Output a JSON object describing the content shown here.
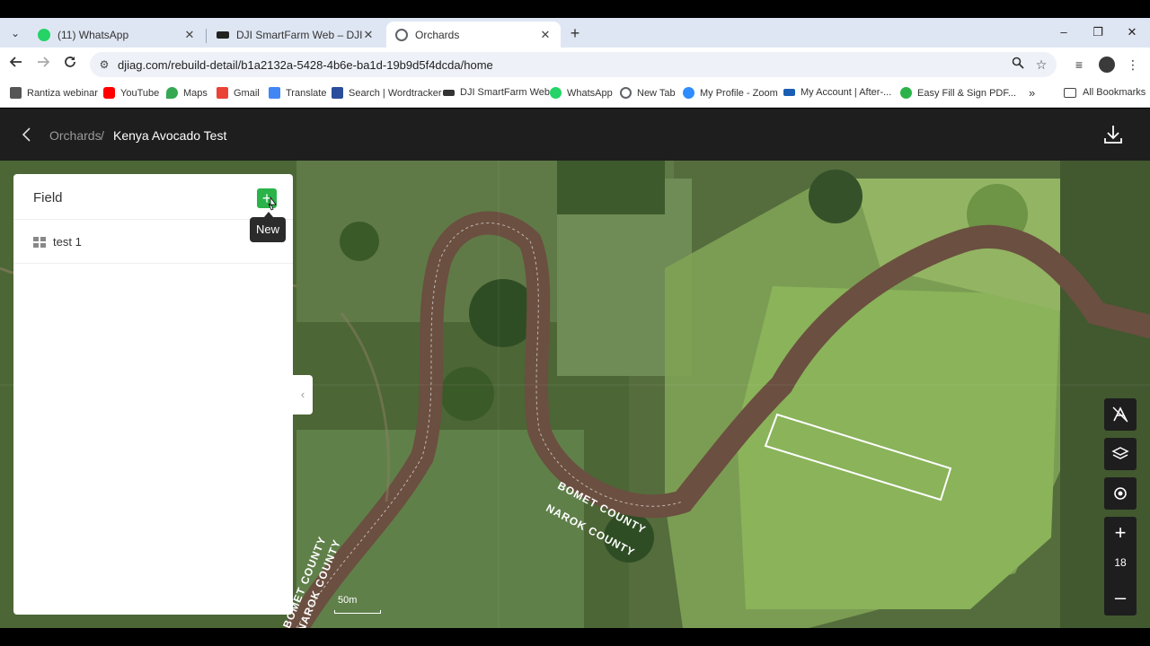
{
  "browser": {
    "tabs": [
      {
        "title": "(11) WhatsApp",
        "close": "✕",
        "favicon_color": "#25d366"
      },
      {
        "title": "DJI SmartFarm Web – DJI agricu",
        "close": "✕",
        "favicon_color": "#222222"
      },
      {
        "title": "Orchards",
        "close": "✕",
        "favicon_color": "#5f6368"
      }
    ],
    "new_tab": "+",
    "window": {
      "minimize": "–",
      "restore": "❐",
      "close": "✕"
    },
    "url": "djiag.com/rebuild-detail/b1a2132a-5428-4b6e-ba1d-19b9d5f4dcda/home",
    "bookmarks": [
      {
        "label": "Rantiza webinar",
        "color": "#555555"
      },
      {
        "label": "YouTube",
        "color": "#ff0000"
      },
      {
        "label": "Maps",
        "color": "#34a853"
      },
      {
        "label": "Gmail",
        "color": "#ea4335"
      },
      {
        "label": "Translate",
        "color": "#4285f4"
      },
      {
        "label": "Search | Wordtracker",
        "color": "#2a4d9b"
      },
      {
        "label": "DJI SmartFarm Web",
        "color": "#333333"
      },
      {
        "label": "WhatsApp",
        "color": "#25d366"
      },
      {
        "label": "New Tab",
        "color": "#5f6368"
      },
      {
        "label": "My Profile - Zoom",
        "color": "#2d8cff"
      },
      {
        "label": "My Account | After-...",
        "color": "#1a5fb4"
      },
      {
        "label": "Easy Fill & Sign PDF...",
        "color": "#2bb34a"
      }
    ],
    "bookmarks_more": "»",
    "all_bookmarks": "All Bookmarks"
  },
  "app": {
    "breadcrumb_root": "Orchards",
    "breadcrumb_sep": "/",
    "breadcrumb_current": "Kenya Avocado Test"
  },
  "panel": {
    "title": "Field",
    "add_label": "+",
    "tooltip": "New",
    "fields": [
      {
        "label": "test 1"
      }
    ],
    "collapse": "‹"
  },
  "map": {
    "zoom_in": "+",
    "zoom_level": "18",
    "zoom_out": "–",
    "scale_label": "50m",
    "labels": [
      "BOMET COUNTY",
      "NAROK COUNTY",
      "BOMET COUNTY",
      "NAROK COUNTY"
    ]
  }
}
